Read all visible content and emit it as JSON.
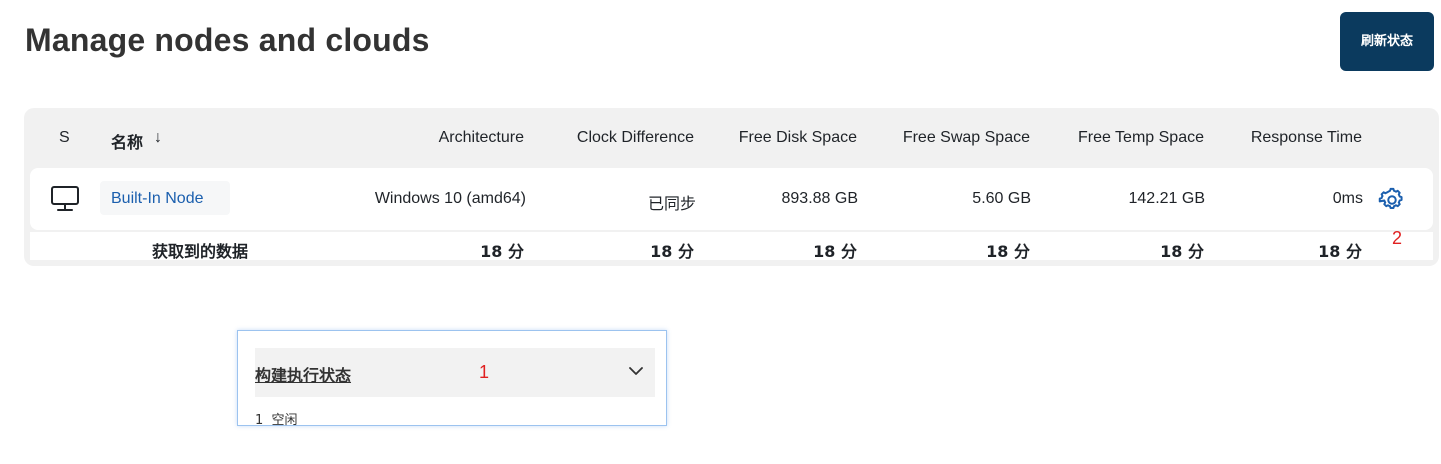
{
  "page": {
    "title": "Manage nodes and clouds",
    "refresh_button": "刷新状态"
  },
  "table": {
    "headers": {
      "status": "S",
      "name": "名称",
      "sort_arrow": "↓",
      "architecture": "Architecture",
      "clock": "Clock Difference",
      "disk": "Free Disk Space",
      "swap": "Free Swap Space",
      "temp": "Free Temp Space",
      "response": "Response Time"
    },
    "rows": [
      {
        "icon": "monitor-icon",
        "name": "Built-In Node",
        "architecture": "Windows 10 (amd64)",
        "clock": "已同步",
        "disk": "893.88 GB",
        "swap": "5.60 GB",
        "temp": "142.21 GB",
        "response": "0ms",
        "settings_icon": "gear-icon"
      }
    ],
    "footer": {
      "label": "获取到的数据",
      "architecture": "18 分",
      "clock": "18 分",
      "disk": "18 分",
      "swap": "18 分",
      "temp": "18 分",
      "response": "18 分"
    }
  },
  "annotations": {
    "one": "1",
    "two": "2",
    "color": "#e02020"
  },
  "executors": {
    "title": "构建执行状态",
    "chevron_icon": "chevron-down-icon",
    "items": [
      {
        "number": "1",
        "status": "空闲"
      }
    ]
  },
  "colors": {
    "accent": "#0b3a5e",
    "link": "#1b5fae",
    "card": "#f1f1f1"
  }
}
